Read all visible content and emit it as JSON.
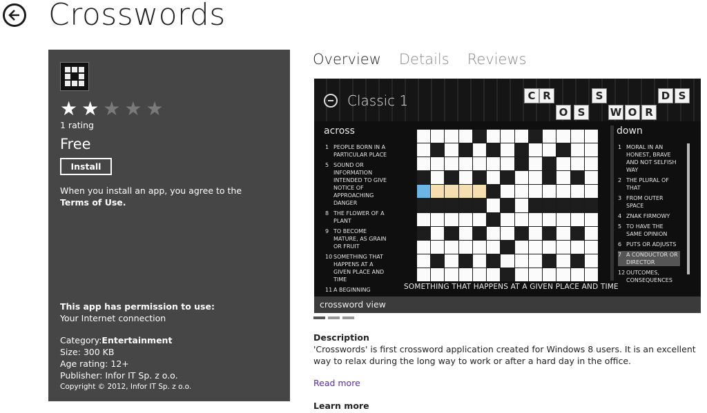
{
  "page": {
    "title": "Crosswords"
  },
  "app": {
    "rating_count": "1 rating",
    "rating_value": 2,
    "rating_max": 5,
    "price": "Free",
    "install_label": "Install",
    "terms_prefix": "When you install an app, you agree to the",
    "terms_link": "Terms of Use.",
    "permissions_heading": "This app has permission to use:",
    "permissions": [
      "Your Internet connection"
    ],
    "category_label": "Category:",
    "category_value": "Entertainment",
    "size": "Size: 300 KB",
    "age": "Age rating: 12+",
    "publisher": "Publisher: Infor IT Sp. z o.o.",
    "copyright": "Copyright © 2012, Infor IT Sp. z o.o."
  },
  "tabs": [
    {
      "label": "Overview",
      "active": true
    },
    {
      "label": "Details",
      "active": false
    },
    {
      "label": "Reviews",
      "active": false
    }
  ],
  "screenshot": {
    "title": "Classic 1",
    "header_letters": [
      "C",
      "R",
      "S",
      "D",
      "S",
      "O",
      "S",
      "W",
      "O",
      "R"
    ],
    "across_heading": "across",
    "down_heading": "down",
    "across": [
      {
        "n": "1",
        "t": "PEOPLE BORN IN A PARTICULAR PLACE"
      },
      {
        "n": "5",
        "t": "SOUND OR INFORMATION INTENDED TO GIVE NOTICE OF APPROACHING DANGER"
      },
      {
        "n": "8",
        "t": "THE FLOWER OF A PLANT"
      },
      {
        "n": "9",
        "t": "TO BECOME MATURE, AS GRAIN OR FRUIT"
      },
      {
        "n": "10",
        "t": "SOMETHING THAT HAPPENS AT A GIVEN PLACE AND TIME"
      },
      {
        "n": "11",
        "t": "A BEGINNING"
      }
    ],
    "down": [
      {
        "n": "1",
        "t": "MORAL IN AN HONEST, BRAVE AND NOT SELFISH WAY"
      },
      {
        "n": "2",
        "t": "THE PLURAL OF THAT"
      },
      {
        "n": "3",
        "t": "FROM OUTER SPACE"
      },
      {
        "n": "4",
        "t": "ZNAK FIRMOWY"
      },
      {
        "n": "5",
        "t": "TO HAVE THE SAME OPINION"
      },
      {
        "n": "6",
        "t": "PUTS OR ADJUSTS"
      },
      {
        "n": "7",
        "t": "A CONDUCTOR OR DIRECTOR"
      },
      {
        "n": "12",
        "t": "OUTCOMES, CONSEQUENCES"
      }
    ],
    "selected_down": 6,
    "answer_hint": "SOMETHING THAT HAPPENS AT A GIVEN PLACE AND TIME",
    "caption": "crossword view",
    "dots": 3,
    "active_dot": 0
  },
  "description": {
    "heading": "Description",
    "text": "'Crosswords' is first crossword application created for Windows 8 users. It is an excellent way to relax during the long way to work or after a hard day in the office.",
    "read_more": "Read more",
    "learn_more": "Learn more"
  },
  "colors": {
    "panel": "#464646",
    "link": "#5a2ab0",
    "highlight": "#f5deb0",
    "selected": "#6cb6e6"
  },
  "icons": {
    "back": "back-arrow-circle-icon",
    "star": "star-icon"
  }
}
